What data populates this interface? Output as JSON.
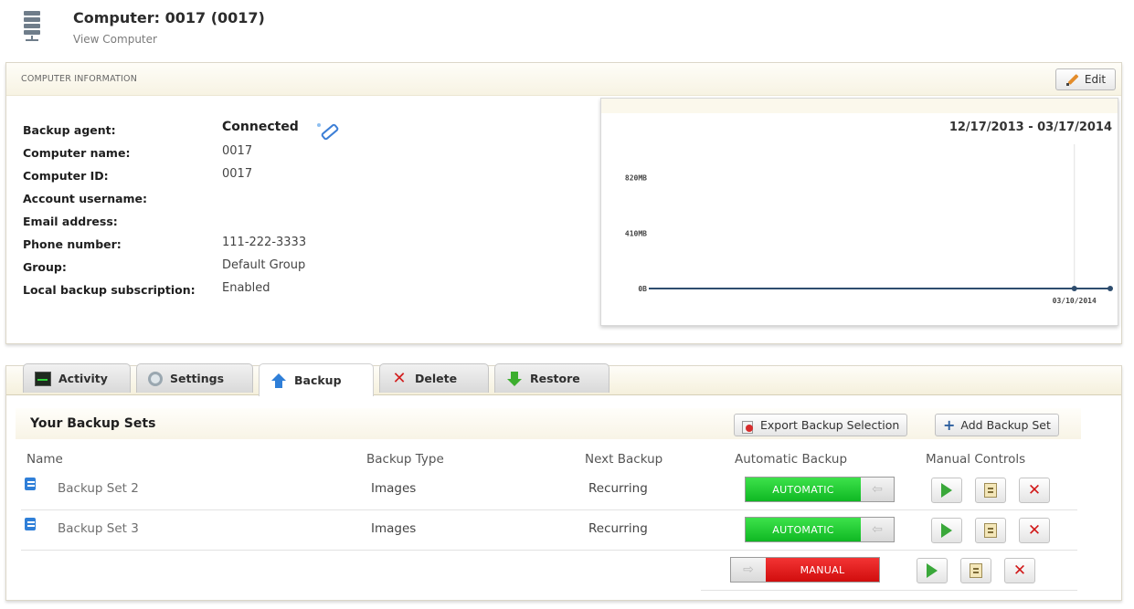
{
  "header": {
    "title": "Computer: 0017 (0017)",
    "subtitle": "View Computer"
  },
  "computer_info": {
    "section_title": "COMPUTER INFORMATION",
    "edit_label": "Edit",
    "fields": [
      {
        "label": "Backup agent:",
        "value": "Connected"
      },
      {
        "label": "Computer name:",
        "value": "0017"
      },
      {
        "label": "Computer ID:",
        "value": "0017"
      },
      {
        "label": "Account username:",
        "value": ""
      },
      {
        "label": "Email address:",
        "value": ""
      },
      {
        "label": "Phone number:",
        "value": "111-222-3333"
      },
      {
        "label": "Group:",
        "value": "Default Group"
      },
      {
        "label": "Local backup subscription:",
        "value": "Enabled"
      }
    ]
  },
  "chart_data": {
    "type": "line",
    "date_range": "12/17/2013 - 03/17/2014",
    "y_tick_labels": [
      "820MB",
      "410MB",
      "0B"
    ],
    "x_tick_labels": [
      "03/10/2014"
    ],
    "x": [
      "12/17/2013",
      "03/10/2014",
      "03/17/2014"
    ],
    "values_mb": [
      0,
      0,
      0
    ],
    "ylim_mb": [
      0,
      1000
    ],
    "line_color": "#2e4d6e"
  },
  "tabs": [
    {
      "label": "Activity",
      "icon": "activity-icon",
      "active": false
    },
    {
      "label": "Settings",
      "icon": "settings-icon",
      "active": false
    },
    {
      "label": "Backup",
      "icon": "backup-icon",
      "active": true
    },
    {
      "label": "Delete",
      "icon": "delete-icon",
      "active": false
    },
    {
      "label": "Restore",
      "icon": "restore-icon",
      "active": false
    }
  ],
  "backup_sets": {
    "title": "Your Backup Sets",
    "export_label": "Export Backup Selection",
    "add_label": "Add Backup Set",
    "columns": {
      "name": "Name",
      "type": "Backup Type",
      "next": "Next Backup",
      "automatic": "Automatic Backup",
      "manual": "Manual Controls"
    },
    "rows": [
      {
        "name": "Backup Set 2",
        "type": "Images",
        "next": "Recurring",
        "mode": "AUTOMATIC"
      },
      {
        "name": "Backup Set 3",
        "type": "Images",
        "next": "Recurring",
        "mode": "AUTOMATIC"
      },
      {
        "name": "",
        "type": "",
        "next": "",
        "mode": "MANUAL"
      }
    ]
  },
  "colors": {
    "automatic": "#14c02a",
    "manual": "#e01d1d",
    "accent": "#2f7fd8"
  }
}
